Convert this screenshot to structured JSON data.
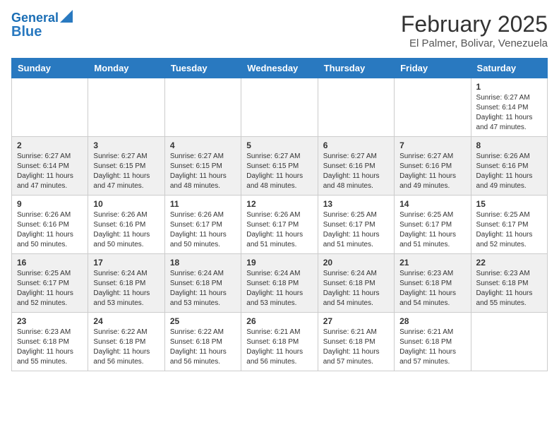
{
  "header": {
    "logo_line1": "General",
    "logo_line2": "Blue",
    "title": "February 2025",
    "subtitle": "El Palmer, Bolivar, Venezuela"
  },
  "weekdays": [
    "Sunday",
    "Monday",
    "Tuesday",
    "Wednesday",
    "Thursday",
    "Friday",
    "Saturday"
  ],
  "weeks": [
    [
      {
        "day": "",
        "info": ""
      },
      {
        "day": "",
        "info": ""
      },
      {
        "day": "",
        "info": ""
      },
      {
        "day": "",
        "info": ""
      },
      {
        "day": "",
        "info": ""
      },
      {
        "day": "",
        "info": ""
      },
      {
        "day": "1",
        "info": "Sunrise: 6:27 AM\nSunset: 6:14 PM\nDaylight: 11 hours\nand 47 minutes."
      }
    ],
    [
      {
        "day": "2",
        "info": "Sunrise: 6:27 AM\nSunset: 6:14 PM\nDaylight: 11 hours\nand 47 minutes."
      },
      {
        "day": "3",
        "info": "Sunrise: 6:27 AM\nSunset: 6:15 PM\nDaylight: 11 hours\nand 47 minutes."
      },
      {
        "day": "4",
        "info": "Sunrise: 6:27 AM\nSunset: 6:15 PM\nDaylight: 11 hours\nand 48 minutes."
      },
      {
        "day": "5",
        "info": "Sunrise: 6:27 AM\nSunset: 6:15 PM\nDaylight: 11 hours\nand 48 minutes."
      },
      {
        "day": "6",
        "info": "Sunrise: 6:27 AM\nSunset: 6:16 PM\nDaylight: 11 hours\nand 48 minutes."
      },
      {
        "day": "7",
        "info": "Sunrise: 6:27 AM\nSunset: 6:16 PM\nDaylight: 11 hours\nand 49 minutes."
      },
      {
        "day": "8",
        "info": "Sunrise: 6:26 AM\nSunset: 6:16 PM\nDaylight: 11 hours\nand 49 minutes."
      }
    ],
    [
      {
        "day": "9",
        "info": "Sunrise: 6:26 AM\nSunset: 6:16 PM\nDaylight: 11 hours\nand 50 minutes."
      },
      {
        "day": "10",
        "info": "Sunrise: 6:26 AM\nSunset: 6:16 PM\nDaylight: 11 hours\nand 50 minutes."
      },
      {
        "day": "11",
        "info": "Sunrise: 6:26 AM\nSunset: 6:17 PM\nDaylight: 11 hours\nand 50 minutes."
      },
      {
        "day": "12",
        "info": "Sunrise: 6:26 AM\nSunset: 6:17 PM\nDaylight: 11 hours\nand 51 minutes."
      },
      {
        "day": "13",
        "info": "Sunrise: 6:25 AM\nSunset: 6:17 PM\nDaylight: 11 hours\nand 51 minutes."
      },
      {
        "day": "14",
        "info": "Sunrise: 6:25 AM\nSunset: 6:17 PM\nDaylight: 11 hours\nand 51 minutes."
      },
      {
        "day": "15",
        "info": "Sunrise: 6:25 AM\nSunset: 6:17 PM\nDaylight: 11 hours\nand 52 minutes."
      }
    ],
    [
      {
        "day": "16",
        "info": "Sunrise: 6:25 AM\nSunset: 6:17 PM\nDaylight: 11 hours\nand 52 minutes."
      },
      {
        "day": "17",
        "info": "Sunrise: 6:24 AM\nSunset: 6:18 PM\nDaylight: 11 hours\nand 53 minutes."
      },
      {
        "day": "18",
        "info": "Sunrise: 6:24 AM\nSunset: 6:18 PM\nDaylight: 11 hours\nand 53 minutes."
      },
      {
        "day": "19",
        "info": "Sunrise: 6:24 AM\nSunset: 6:18 PM\nDaylight: 11 hours\nand 53 minutes."
      },
      {
        "day": "20",
        "info": "Sunrise: 6:24 AM\nSunset: 6:18 PM\nDaylight: 11 hours\nand 54 minutes."
      },
      {
        "day": "21",
        "info": "Sunrise: 6:23 AM\nSunset: 6:18 PM\nDaylight: 11 hours\nand 54 minutes."
      },
      {
        "day": "22",
        "info": "Sunrise: 6:23 AM\nSunset: 6:18 PM\nDaylight: 11 hours\nand 55 minutes."
      }
    ],
    [
      {
        "day": "23",
        "info": "Sunrise: 6:23 AM\nSunset: 6:18 PM\nDaylight: 11 hours\nand 55 minutes."
      },
      {
        "day": "24",
        "info": "Sunrise: 6:22 AM\nSunset: 6:18 PM\nDaylight: 11 hours\nand 56 minutes."
      },
      {
        "day": "25",
        "info": "Sunrise: 6:22 AM\nSunset: 6:18 PM\nDaylight: 11 hours\nand 56 minutes."
      },
      {
        "day": "26",
        "info": "Sunrise: 6:21 AM\nSunset: 6:18 PM\nDaylight: 11 hours\nand 56 minutes."
      },
      {
        "day": "27",
        "info": "Sunrise: 6:21 AM\nSunset: 6:18 PM\nDaylight: 11 hours\nand 57 minutes."
      },
      {
        "day": "28",
        "info": "Sunrise: 6:21 AM\nSunset: 6:18 PM\nDaylight: 11 hours\nand 57 minutes."
      },
      {
        "day": "",
        "info": ""
      }
    ]
  ]
}
